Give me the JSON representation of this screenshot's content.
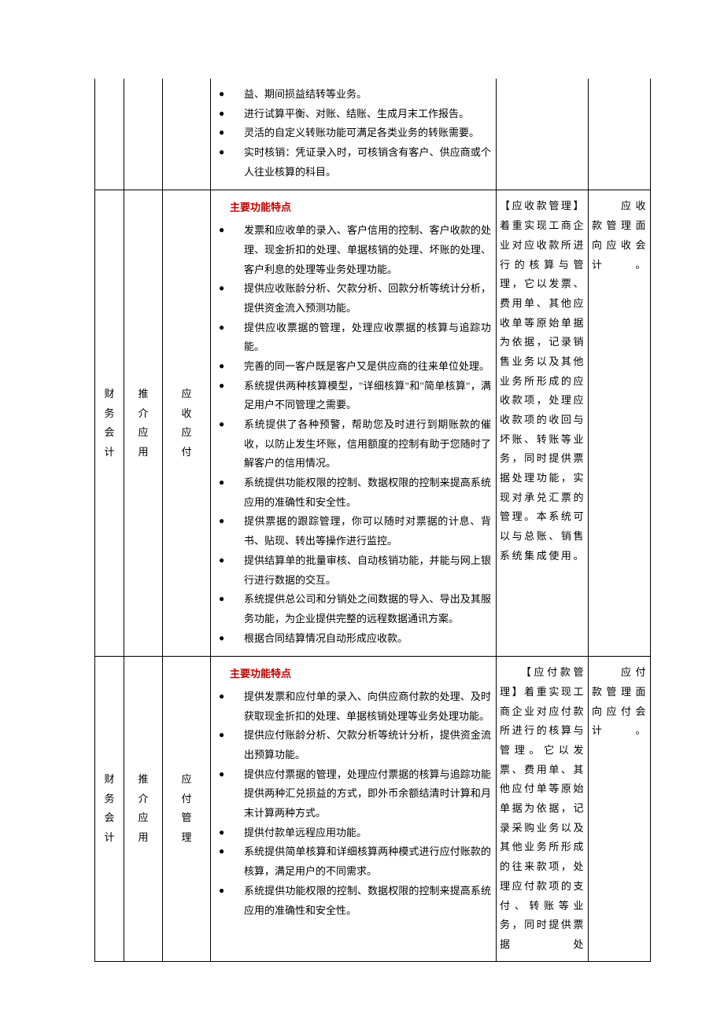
{
  "rows": [
    {
      "col1": "",
      "col2": "",
      "col3": "",
      "features_header": "",
      "features": [
        "益、期间损益结转等业务。",
        "进行试算平衡、对账、结账、生成月末工作报告。",
        "灵活的自定义转账功能可满足各类业务的转账需要。",
        "实时核销：凭证录入时，可核销含有客户、供应商或个人往业核算的科目。"
      ],
      "col5": "",
      "col6": ""
    },
    {
      "col1": "财务会计",
      "col2": "推介应用",
      "col3": "应收应付",
      "features_header": "主要功能特点",
      "features": [
        "发票和应收单的录入、客户信用的控制、客户收款的处理、现金折扣的处理、单据核销的处理、坏账的处理、客户利息的处理等业务处理功能。",
        "提供应收账龄分析、欠款分析、回款分析等统计分析，提供资金流入预测功能。",
        "提供应收票据的管理，处理应收票据的核算与追踪功能。",
        "完善的同一客户既是客户又是供应商的往来单位处理。",
        "系统提供两种核算模型，\"详细核算\"和\"简单核算\"，满足用户不同管理之需要。",
        "系统提供了各种预警，帮助您及时进行到期账款的催收，以防止发生坏账，信用额度的控制有助于您随时了解客户的信用情况。",
        "系统提供功能权限的控制、数据权限的控制来提高系统应用的准确性和安全性。",
        "提供票据的跟踪管理，你可以随时对票据的计息、背书、贴现、转出等操作进行监控。",
        "提供结算单的批量审核、自动核销功能，并能与网上银行进行数据的交互。",
        "系统提供总公司和分销处之间数据的导入、导出及其服务功能，为企业提供完整的远程数据通讯方案。",
        "根据合同结算情况自动形成应收款。"
      ],
      "col5_lead": "【应收款管理】",
      "col5_body": "着重实现工商企业对应收款所进行的核算与管理，它以发票、费用单、其他应收单等原始单据为依据，记录销售业务以及其他业务所形成的应收款项，处理应收款项的收回与坏账、转账等业务，同时提供票据处理功能，实现对承兑汇票的管理。本系统可以与总账、销售系统集成使用。",
      "col6_lead": "　　应收",
      "col6_body": "款管理面向应收会计。"
    },
    {
      "col1": "财务会计",
      "col2": "推介应用",
      "col3": "应付管理",
      "features_header": "主要功能特点",
      "features": [
        "提供发票和应付单的录入、向供应商付款的处理、及时获取现金折扣的处理、单据核销处理等业务处理功能。",
        "提供应付账龄分析、欠款分析等统计分析，提供资金流出预算功能。",
        "提供应付票据的管理，处理应付票据的核算与追踪功能提供两种汇兑损益的方式，即外币余额结清时计算和月末计算两种方式。",
        "提供付款单远程应用功能。",
        "系统提供简单核算和详细核算两种模式进行应付账款的核算，满足用户的不同需求。",
        "系统提供功能权限的控制、数据权限的控制来提高系统应用的准确性和安全性。"
      ],
      "col5_lead": "　　【应付款",
      "col5_body": "管理】着重实现工商企业对应付款所进行的核算与管理。它以发票、费用单、其他应付单等原始单据为依据，记录采购业务以及其他业务所形成的往来款项，处理应付款项的支付、转账等业务，同时提供票据处",
      "col6_lead": "　　应付",
      "col6_body": "款管理面向应付会计。"
    }
  ]
}
